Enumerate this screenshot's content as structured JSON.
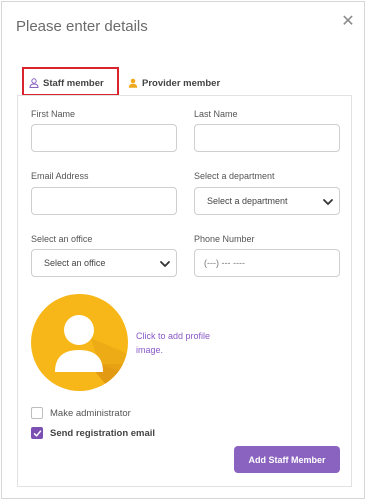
{
  "modal": {
    "title": "Please enter details",
    "close_icon": "close-icon",
    "close_glyph": "✕"
  },
  "tabs": [
    {
      "label": "Staff member",
      "icon": "user-outline-icon",
      "icon_color": "#8a63c0",
      "active": true
    },
    {
      "label": "Provider member",
      "icon": "user-filled-icon",
      "icon_color": "#f0a81c",
      "active": false
    }
  ],
  "form": {
    "first_name": {
      "label": "First Name",
      "value": ""
    },
    "last_name": {
      "label": "Last Name",
      "value": ""
    },
    "email": {
      "label": "Email Address",
      "value": ""
    },
    "department": {
      "label": "Select a department",
      "selected": "Select a department"
    },
    "office": {
      "label": "Select an office",
      "selected": "Select an office"
    },
    "phone": {
      "label": "Phone Number",
      "placeholder": "(---) --- ----"
    }
  },
  "profile_image": {
    "icon": "avatar-placeholder-icon",
    "link_text": "Click to add profile image."
  },
  "options": {
    "make_admin": {
      "label": "Make administrator",
      "checked": false
    },
    "send_email": {
      "label": "Send registration email",
      "checked": true
    }
  },
  "submit_label": "Add Staff Member",
  "colors": {
    "accent": "#8a63c0",
    "highlight": "#d9232d",
    "avatar": "#f7b718"
  }
}
